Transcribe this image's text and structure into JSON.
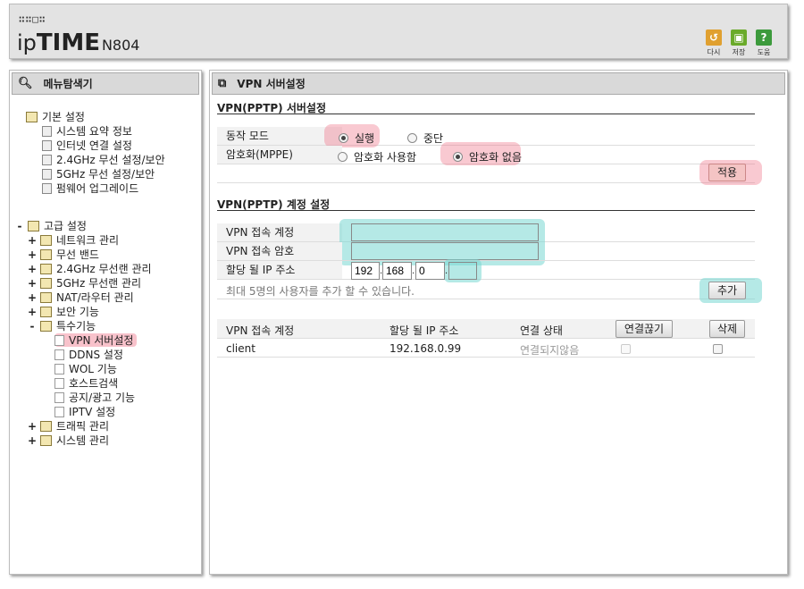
{
  "header": {
    "logo_dots": "∷∷□∷",
    "brand_light": "ip",
    "brand_bold": "TIME",
    "model": "N804",
    "buttons": [
      {
        "label": "다시",
        "icon": "refresh-icon",
        "glyph": "↺",
        "color": "#e0a030"
      },
      {
        "label": "저장",
        "icon": "save-icon",
        "glyph": "▣",
        "color": "#6aaa2a"
      },
      {
        "label": "도움",
        "icon": "help-icon",
        "glyph": "?",
        "color": "#3c9a3c"
      }
    ]
  },
  "sidebar": {
    "title": "메뉴탐색기",
    "basic": {
      "label": "기본 설정",
      "items": [
        "시스템 요약 정보",
        "인터넷 연결 설정",
        "2.4GHz 무선 설정/보안",
        "5GHz 무선 설정/보안",
        "펌웨어 업그레이드"
      ]
    },
    "advanced": {
      "toggle": "-",
      "label": "고급 설정",
      "items": [
        {
          "toggle": "+",
          "label": "네트워크 관리"
        },
        {
          "toggle": "+",
          "label": "무선 밴드"
        },
        {
          "toggle": "+",
          "label": "2.4GHz 무선랜 관리"
        },
        {
          "toggle": "+",
          "label": "5GHz 무선랜 관리"
        },
        {
          "toggle": "+",
          "label": "NAT/라우터 관리"
        },
        {
          "toggle": "+",
          "label": "보안 기능"
        },
        {
          "toggle": "-",
          "label": "특수기능"
        }
      ],
      "special_items": [
        "VPN 서버설정",
        "DDNS 설정",
        "WOL 기능",
        "호스트검색",
        "공지/광고 기능",
        "IPTV 설정"
      ],
      "tail_items": [
        {
          "toggle": "+",
          "label": "트래픽 관리"
        },
        {
          "toggle": "+",
          "label": "시스템 관리"
        }
      ]
    }
  },
  "main": {
    "title": "VPN 서버설정",
    "server_section": {
      "title": "VPN(PPTP) 서버설정",
      "mode_label": "동작 모드",
      "mode_options": [
        "실행",
        "중단"
      ],
      "mode_selected": "실행",
      "encrypt_label": "암호화(MPPE)",
      "encrypt_options": [
        "암호화 사용함",
        "암호화 없음"
      ],
      "encrypt_selected": "암호화 없음",
      "apply_button": "적용"
    },
    "account_section": {
      "title": "VPN(PPTP) 계정 설정",
      "account_label": "VPN 접속 계정",
      "account_value": "",
      "password_label": "VPN 접속 암호",
      "password_value": "",
      "ip_label": "할당 될 IP 주소",
      "ip_parts": [
        "192",
        "168",
        "0",
        ""
      ],
      "notice": "최대 5명의 사용자를 추가 할 수 있습니다.",
      "add_button": "추가"
    },
    "table": {
      "headers": [
        "VPN 접속 계정",
        "할당 될 IP 주소",
        "연결 상태"
      ],
      "disconnect_button": "연결끊기",
      "delete_button": "삭제",
      "rows": [
        {
          "account": "client",
          "ip": "192.168.0.99",
          "status": "연결되지않음"
        }
      ]
    }
  }
}
